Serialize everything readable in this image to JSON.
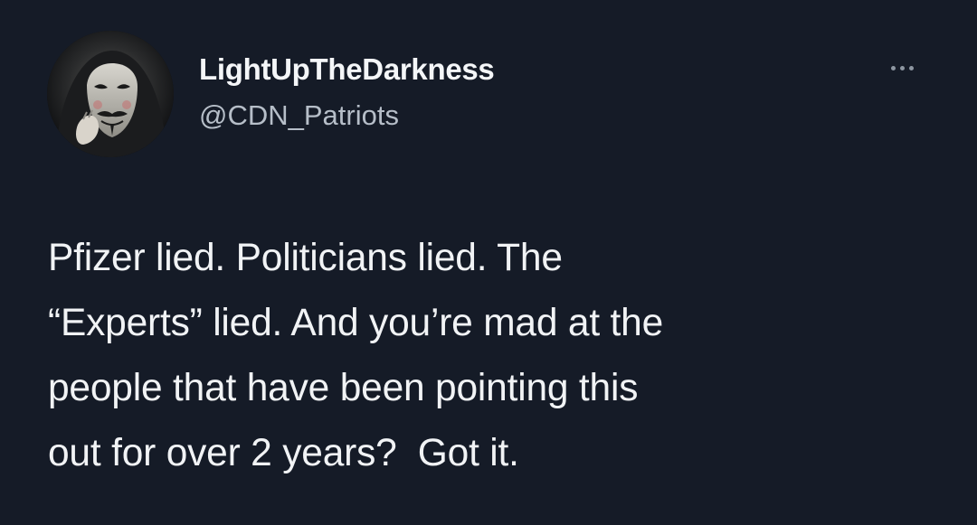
{
  "tweet": {
    "display_name": "LightUpTheDarkness",
    "handle": "@CDN_Patriots",
    "more_icon": "more-horizontal-icon",
    "avatar_icon": "masked-face-avatar",
    "text_lines": [
      "Pfizer lied. Politicians lied. The",
      "“Experts” lied. And you’re mad at the",
      "people that have been pointing this",
      "out for over 2 years?  Got it."
    ]
  },
  "colors": {
    "background": "#151b27",
    "text_primary": "#f1f3f5",
    "text_secondary": "#b6bec8",
    "icon_muted": "#8d96a1"
  }
}
